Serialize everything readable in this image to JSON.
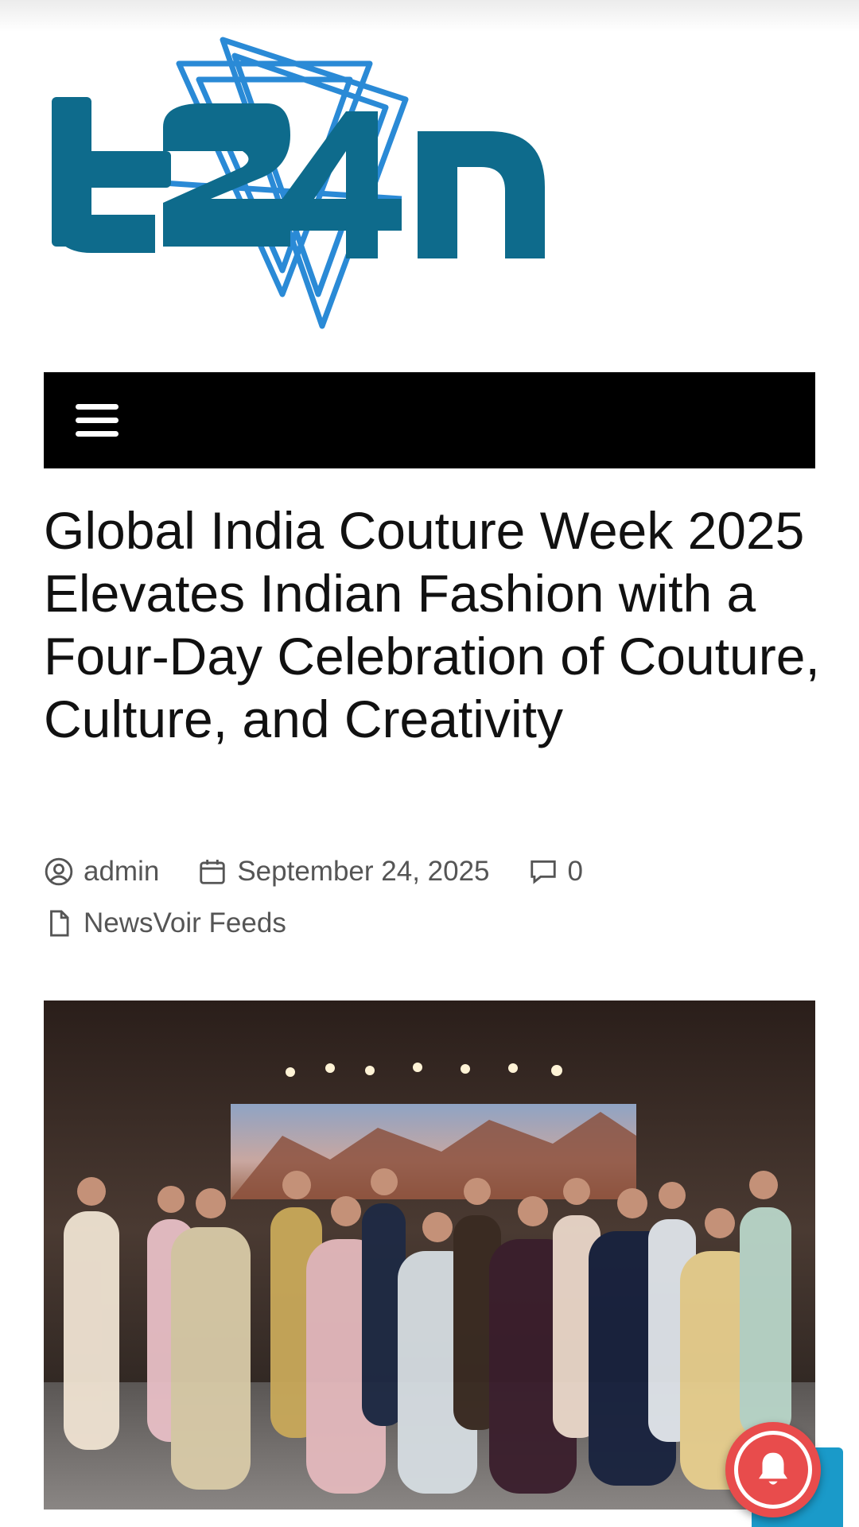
{
  "site": {
    "logo_text": "t24n",
    "brand_color": "#0e6b8c",
    "logo_accent_color": "#2a8ad6"
  },
  "nav": {
    "menu_icon": "hamburger-menu-icon"
  },
  "article": {
    "title": "Global India Couture Week 2025 Elevates Indian Fashion with a Four-Day Celebration of Couture, Culture, and Creativity",
    "author": "admin",
    "date": "September 24, 2025",
    "comments": "0",
    "category": "NewsVoir Feeds",
    "icons": {
      "author": "user-circle-icon",
      "date": "calendar-icon",
      "comments": "comment-icon",
      "category": "file-icon"
    }
  },
  "widgets": {
    "notification_icon": "bell-icon",
    "notification_color": "#e84c4c",
    "scroll_top_color": "#1a9ac9"
  }
}
